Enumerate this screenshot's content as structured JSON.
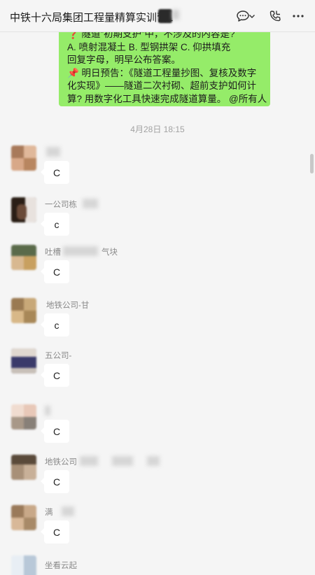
{
  "header": {
    "title": "中铁十六局集团工程量精算实训营1"
  },
  "pinned_message": {
    "lines": [
      "❓ 隧道“初期支护”中，不涉及的内容是?",
      "A. 喷射混凝土 B. 型钢拱架 C. 仰拱填充",
      "回复字母，明早公布答案。",
      "📌 明日预告：《隧道工程量抄图、复核及数字",
      "化实现》——隧道二次衬砌、超前支护如何计",
      "算? 用数字化工具快速完成隧道算量。 @所有人"
    ]
  },
  "timestamp": "4月28日 18:15",
  "messages": [
    {
      "sender": "",
      "text": "C"
    },
    {
      "sender": "一公司栋",
      "text": "c"
    },
    {
      "sender": "吐槽",
      "sender_tail": "气块",
      "text": "C"
    },
    {
      "sender": "地铁公司-甘",
      "text": "c"
    },
    {
      "sender": "五公司-",
      "text": "C"
    },
    {
      "sender": "",
      "text": "C"
    },
    {
      "sender": "地铁公司",
      "text": "C"
    },
    {
      "sender": "满",
      "text": "C"
    },
    {
      "sender": "坐看云起",
      "text": ""
    }
  ],
  "icons": {
    "chat": "chat-bubble-icon",
    "dropdown": "chevron-down-icon",
    "call": "phone-call-icon",
    "more": "more-dots-icon"
  }
}
